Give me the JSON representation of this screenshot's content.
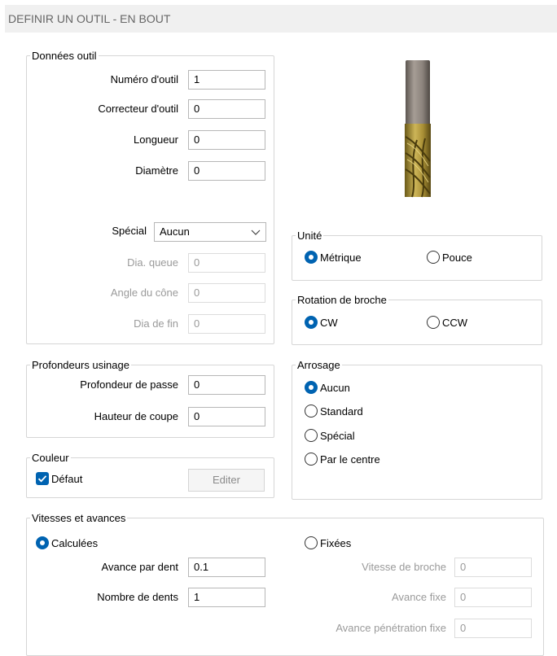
{
  "title": "DEFINIR UN OUTIL - EN BOUT",
  "tool_data": {
    "legend": "Données outil",
    "tool_number": {
      "label": "Numéro d'outil",
      "value": "1"
    },
    "tool_corrector": {
      "label": "Correcteur d'outil",
      "value": "0"
    },
    "length": {
      "label": "Longueur",
      "value": "0"
    },
    "diameter": {
      "label": "Diamètre",
      "value": "0"
    },
    "special": {
      "label": "Spécial",
      "value": "Aucun"
    },
    "tail_dia": {
      "label": "Dia. queue",
      "value": "0"
    },
    "cone_angle": {
      "label": "Angle du cône",
      "value": "0"
    },
    "end_dia": {
      "label": "Dia de fin",
      "value": "0"
    }
  },
  "depths": {
    "legend": "Profondeurs usinage",
    "pass_depth": {
      "label": "Profondeur de passe",
      "value": "0"
    },
    "cut_height": {
      "label": "Hauteur de coupe",
      "value": "0"
    }
  },
  "color": {
    "legend": "Couleur",
    "default_label": "Défaut",
    "default_checked": true,
    "edit_label": "Editer"
  },
  "unit": {
    "legend": "Unité",
    "options": [
      "Métrique",
      "Pouce"
    ],
    "selected": "Métrique"
  },
  "spindle": {
    "legend": "Rotation de broche",
    "options": [
      "CW",
      "CCW"
    ],
    "selected": "CW"
  },
  "coolant": {
    "legend": "Arrosage",
    "options": [
      "Aucun",
      "Standard",
      "Spécial",
      "Par le centre"
    ],
    "selected": "Aucun"
  },
  "speeds": {
    "legend": "Vitesses et avances",
    "calculated_label": "Calculées",
    "fixed_label": "Fixées",
    "mode": "Calculées",
    "feed_per_tooth": {
      "label": "Avance par dent",
      "value": "0.1"
    },
    "num_teeth": {
      "label": "Nombre de dents",
      "value": "1"
    },
    "spindle_speed": {
      "label": "Vitesse de broche",
      "value": "0"
    },
    "fixed_feed": {
      "label": "Avance fixe",
      "value": "0"
    },
    "plunge_feed": {
      "label": "Avance pénétration fixe",
      "value": "0"
    }
  },
  "colors": {
    "accent": "#0063b1",
    "tool_gold": "#b9a24a",
    "tool_shank": "#8b837c"
  }
}
